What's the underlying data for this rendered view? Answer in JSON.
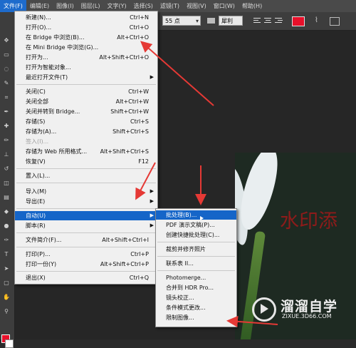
{
  "menubar": {
    "items": [
      "文件(F)",
      "编辑(E)",
      "图像(I)",
      "图层(L)",
      "文字(Y)",
      "选择(S)",
      "滤镜(T)",
      "视图(V)",
      "窗口(W)",
      "帮助(H)"
    ]
  },
  "options": {
    "font_size": "55 点",
    "antialias": "犀利",
    "text_color": "#e8102a"
  },
  "file_menu": {
    "items": [
      {
        "label": "新建(N)...",
        "shortcut": "Ctrl+N"
      },
      {
        "label": "打开(O)...",
        "shortcut": "Ctrl+O"
      },
      {
        "label": "在 Bridge 中浏览(B)...",
        "shortcut": "Alt+Ctrl+O"
      },
      {
        "label": "在 Mini Bridge 中浏览(G)...",
        "shortcut": ""
      },
      {
        "label": "打开为...",
        "shortcut": "Alt+Shift+Ctrl+O"
      },
      {
        "label": "打开为智能对象...",
        "shortcut": ""
      },
      {
        "label": "最近打开文件(T)",
        "shortcut": ""
      },
      {
        "label": "关闭(C)",
        "shortcut": "Ctrl+W"
      },
      {
        "label": "关闭全部",
        "shortcut": "Alt+Ctrl+W"
      },
      {
        "label": "关闭并转到 Bridge...",
        "shortcut": "Shift+Ctrl+W"
      },
      {
        "label": "存储(S)",
        "shortcut": "Ctrl+S"
      },
      {
        "label": "存储为(A)...",
        "shortcut": "Shift+Ctrl+S"
      },
      {
        "label": "签入(I)...",
        "shortcut": ""
      },
      {
        "label": "存储为 Web 所用格式...",
        "shortcut": "Alt+Shift+Ctrl+S"
      },
      {
        "label": "恢复(V)",
        "shortcut": "F12"
      },
      {
        "label": "置入(L)...",
        "shortcut": ""
      },
      {
        "label": "导入(M)",
        "shortcut": ""
      },
      {
        "label": "导出(E)",
        "shortcut": ""
      },
      {
        "label": "自动(U)",
        "shortcut": ""
      },
      {
        "label": "脚本(R)",
        "shortcut": ""
      },
      {
        "label": "文件简介(F)...",
        "shortcut": "Alt+Shift+Ctrl+I"
      },
      {
        "label": "打印(P)...",
        "shortcut": "Ctrl+P"
      },
      {
        "label": "打印一份(Y)",
        "shortcut": "Alt+Shift+Ctrl+P"
      },
      {
        "label": "退出(X)",
        "shortcut": "Ctrl+Q"
      }
    ]
  },
  "automate_menu": {
    "items": [
      "批处理(B)...",
      "PDF 演示文稿(P)...",
      "创建快捷批处理(C)...",
      "裁剪并修齐照片",
      "联系表 II...",
      "Photomerge...",
      "合并到 HDR Pro...",
      "镜头校正...",
      "条件模式更改...",
      "限制图像..."
    ]
  },
  "canvas": {
    "watermark_text": "水印添"
  },
  "logo": {
    "name": "溜溜自学",
    "url": "ZIXUE.3D66.COM"
  }
}
